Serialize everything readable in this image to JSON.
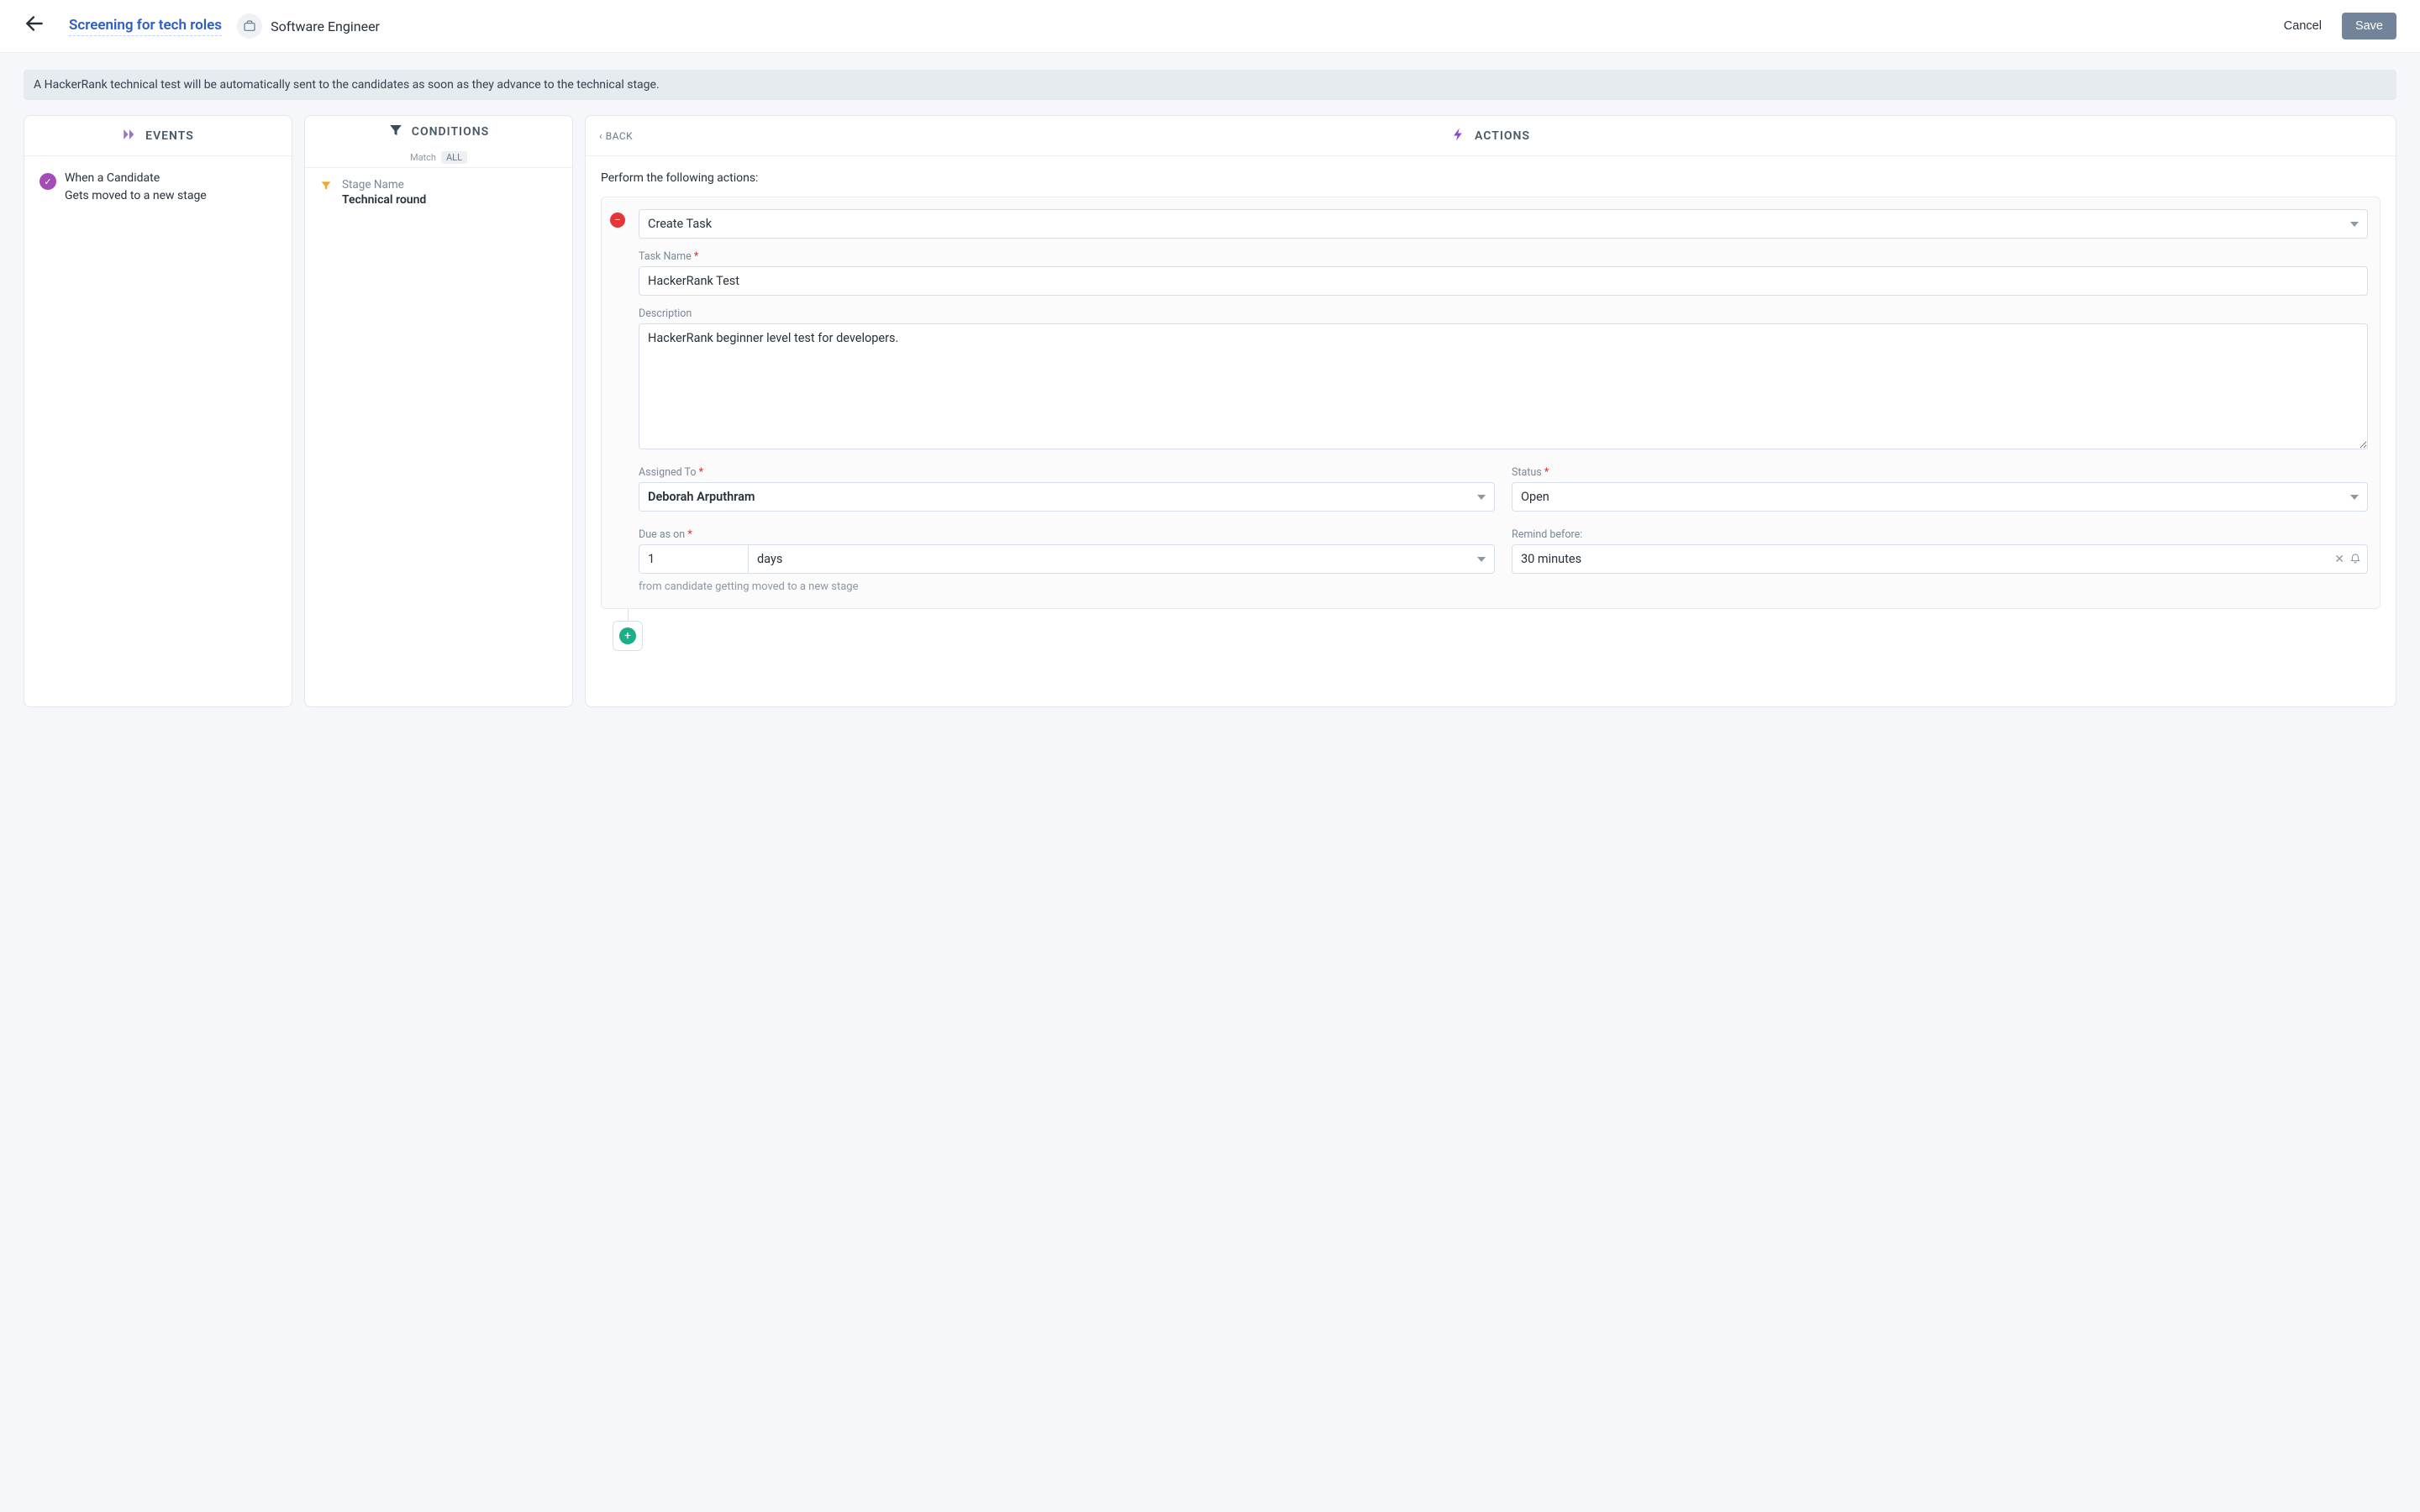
{
  "header": {
    "rule_name": "Screening for tech roles",
    "role_name": "Software Engineer",
    "cancel_label": "Cancel",
    "save_label": "Save"
  },
  "info_banner": "A HackerRank technical test will be automatically sent to the candidates as soon as they advance to the technical stage.",
  "events": {
    "title": "EVENTS",
    "item_line1": "When a Candidate",
    "item_line2": "Gets moved to a new stage"
  },
  "conditions": {
    "title": "CONDITIONS",
    "match_label": "Match",
    "match_chip": "ALL",
    "item_label": "Stage Name",
    "item_value": "Technical round"
  },
  "actions": {
    "back_label": "BACK",
    "title": "ACTIONS",
    "perform_label": "Perform the following actions:",
    "action_type": "Create Task",
    "task_name_label": "Task Name",
    "task_name_value": "HackerRank Test",
    "desc_label": "Description",
    "desc_value": "HackerRank beginner level test for developers.",
    "assigned_label": "Assigned To",
    "assigned_value": "Deborah Arputhram",
    "status_label": "Status",
    "status_value": "Open",
    "due_label": "Due as on",
    "due_number": "1",
    "due_unit": "days",
    "due_helper": "from candidate getting moved to a new stage",
    "remind_label": "Remind before:",
    "remind_value": "30 minutes"
  }
}
